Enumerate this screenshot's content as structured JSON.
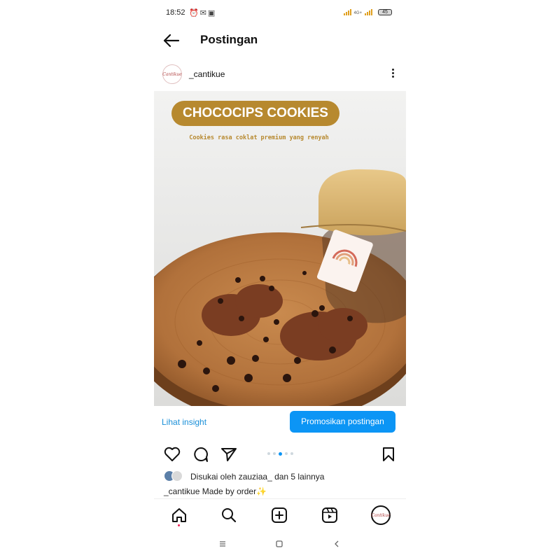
{
  "status_bar": {
    "time": "18:52",
    "icons": [
      "alarm-icon",
      "gmail-icon",
      "shopping-bag-icon"
    ],
    "network_label": "4G+",
    "battery": "45"
  },
  "header": {
    "title": "Postingan",
    "back_icon": "arrow-left-icon"
  },
  "post": {
    "username": "_cantikue",
    "avatar_text": "Cantikue",
    "more_icon": "more-vertical-icon",
    "image": {
      "banner_title": "CHOCOCIPS COOKIES",
      "banner_subtitle": "Cookies rasa coklat premium yang renyah",
      "accent_color": "#b7892f"
    },
    "insight_label": "Lihat insight",
    "promote_label": "Promosikan postingan",
    "actions": [
      "heart-icon",
      "comment-icon",
      "share-icon",
      "bookmark-icon"
    ],
    "carousel": {
      "count": 5,
      "active": 3
    },
    "likes_text": "Disukai oleh zauziaa_ dan 5 lainnya",
    "caption": "_cantikue Made by order✨"
  },
  "bottom_nav": {
    "items": [
      "home-icon",
      "search-icon",
      "new-post-icon",
      "reels-icon",
      "profile-avatar"
    ],
    "profile_text": "Cantikue"
  },
  "system_nav": [
    "menu-icon",
    "home-square-icon",
    "back-chevron-icon"
  ],
  "colors": {
    "link_blue": "#1a8fd8",
    "button_blue": "#0c95f5",
    "notification_red": "#ee1d52"
  }
}
